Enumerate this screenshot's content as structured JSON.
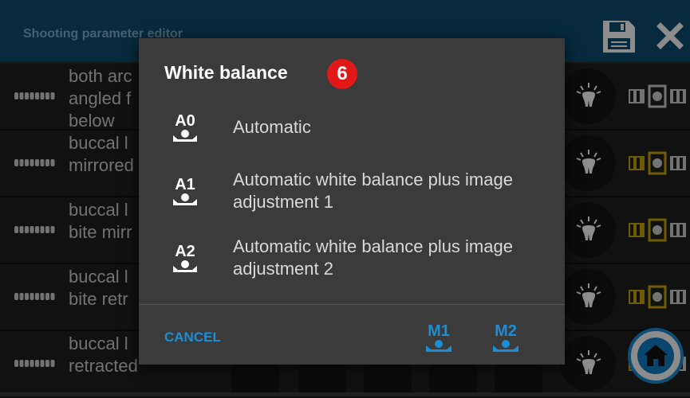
{
  "header": {
    "title": "Shooting parameter editor",
    "save_icon": "save-icon",
    "close_icon": "close-icon"
  },
  "list_rows": [
    {
      "label_lines": [
        "both arc",
        "angled f",
        "below"
      ]
    },
    {
      "label_lines": [
        "buccal l",
        "mirrored"
      ]
    },
    {
      "label_lines": [
        "buccal l",
        "bite mirr"
      ]
    },
    {
      "label_lines": [
        "buccal l",
        "bite retr"
      ]
    },
    {
      "label_lines": [
        "buccal l",
        "retracted"
      ]
    }
  ],
  "dialog": {
    "title": "White balance",
    "badge": "6",
    "options": [
      {
        "code": "A0",
        "text": "Automatic"
      },
      {
        "code": "A1",
        "text": "Automatic white balance plus image adjustment 1"
      },
      {
        "code": "A2",
        "text": "Automatic white balance plus image adjustment 2"
      }
    ],
    "cancel_label": "CANCEL",
    "manual_buttons": [
      {
        "code": "M1"
      },
      {
        "code": "M2"
      }
    ]
  },
  "colors": {
    "accent": "#1a8fd8",
    "badge": "#e01818",
    "header_bg": "#0d4d72",
    "dialog_bg": "#3b3b3b",
    "pattern_yellow": "#c8a800"
  }
}
